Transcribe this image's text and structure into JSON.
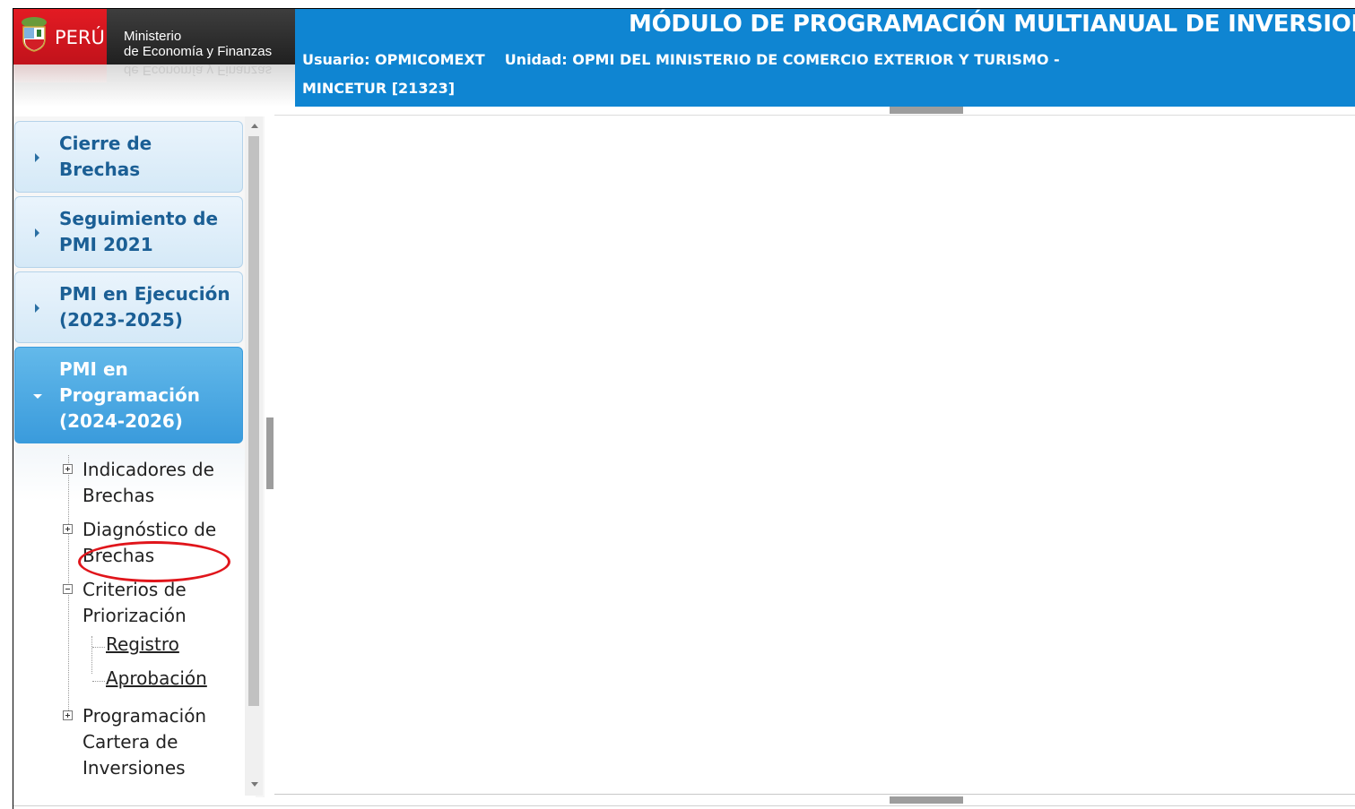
{
  "header": {
    "logo_country": "PERÚ",
    "logo_line1": "Ministerio",
    "logo_line2": "de Economía y Finanzas",
    "title": "MÓDULO DE PROGRAMACIÓN MULTIANUAL DE INVERSION",
    "usuario": "Usuario: OPMICOMEXT",
    "unidad_line1": "Unidad: OPMI DEL MINISTERIO DE COMERCIO EXTERIOR Y TURISMO -",
    "unidad_line2": "MINCETUR  [21323]",
    "bg_color": "#0f85d2"
  },
  "sidebar": {
    "panels": [
      {
        "label": "Cierre de Brechas",
        "expanded": false
      },
      {
        "label": "Seguimiento de PMI 2021",
        "expanded": false
      },
      {
        "label": "PMI en Ejecución (2023-2025)",
        "expanded": false
      },
      {
        "label": "PMI en Programación (2024-2026)",
        "expanded": true
      }
    ],
    "tree": [
      {
        "label": "Indicadores de Brechas",
        "state": "collapsed"
      },
      {
        "label": "Diagnóstico de Brechas",
        "state": "collapsed"
      },
      {
        "label": "Criterios de Priorización",
        "state": "expanded",
        "children": [
          {
            "label": "Registro",
            "highlighted": true
          },
          {
            "label": "Aprobación",
            "highlighted": false
          }
        ]
      },
      {
        "label": "Programación Cartera de Inversiones",
        "state": "collapsed"
      }
    ]
  },
  "colors": {
    "active_panel": "#3a9bdc",
    "highlight_circle": "#e0151b"
  }
}
